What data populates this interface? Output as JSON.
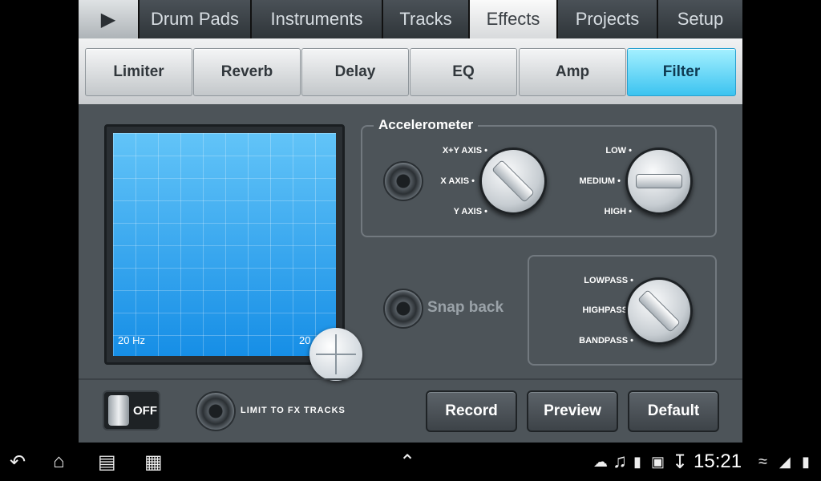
{
  "nav": {
    "play_icon": "play-icon",
    "tabs": [
      "Drum Pads",
      "Instruments",
      "Tracks",
      "Effects",
      "Projects",
      "Setup"
    ],
    "active_tab": "Effects"
  },
  "effects_tabs": {
    "tabs": [
      "Limiter",
      "Reverb",
      "Delay",
      "EQ",
      "Amp",
      "Filter"
    ],
    "active_tab": "Filter"
  },
  "xy_pad": {
    "min_label": "20 Hz",
    "max_label": "20"
  },
  "accelerometer": {
    "title": "Accelerometer",
    "axis_options": [
      "X+Y AXIS",
      "X AXIS",
      "Y AXIS"
    ],
    "sensitivity_options": [
      "LOW",
      "MEDIUM",
      "HIGH"
    ]
  },
  "snap_back": {
    "label": "Snap back"
  },
  "filter_type": {
    "options": [
      "LOWPASS",
      "HIGHPASS",
      "BANDPASS"
    ]
  },
  "bottom": {
    "switch_label": "OFF",
    "limit_label": "LIMIT TO FX TRACKS",
    "record_label": "Record",
    "preview_label": "Preview",
    "default_label": "Default"
  },
  "status_bar": {
    "time": "15:21",
    "icons": [
      "back-icon",
      "home-icon",
      "recent-apps-icon",
      "screenshot-icon",
      "up-arrow-icon",
      "soundcloud-icon",
      "music-icon",
      "sd-card-icon",
      "image-icon",
      "download-icon",
      "wifi-icon",
      "signal-icon",
      "battery-icon"
    ]
  },
  "colors": {
    "accent": "#3cc3f0",
    "pad_blue": "#33a4ef"
  }
}
